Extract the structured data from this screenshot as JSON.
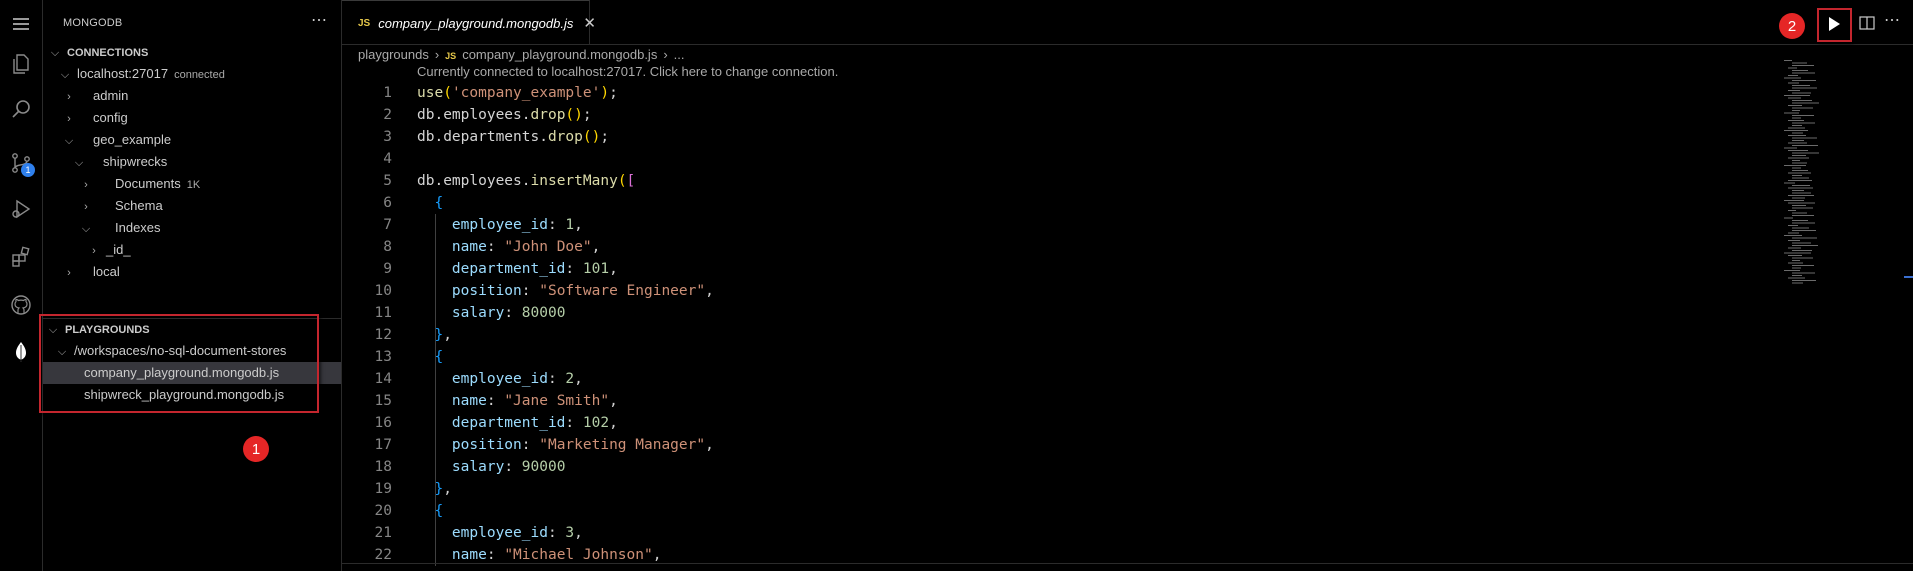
{
  "sidebar": {
    "title": "MONGODB",
    "connections_header": "CONNECTIONS",
    "connection": {
      "name": "localhost:27017",
      "status": "connected"
    },
    "tree": {
      "admin": "admin",
      "config": "config",
      "geo_example": "geo_example",
      "shipwrecks": "shipwrecks",
      "documents": "Documents",
      "documents_count": "1K",
      "schema": "Schema",
      "indexes": "Indexes",
      "id_index": "_id_",
      "local": "local"
    },
    "playgrounds_header": "PLAYGROUNDS",
    "playground_folder": "/workspaces/no-sql-document-stores",
    "playground_files": [
      "company_playground.mongodb.js",
      "shipwreck_playground.mongodb.js"
    ]
  },
  "activity": {
    "scm_badge": "1"
  },
  "annotations": {
    "step1": "1",
    "step2": "2"
  },
  "editor": {
    "tab_lang": "JS",
    "tab_title": "company_playground.mongodb.js",
    "breadcrumb": [
      "playgrounds",
      "company_playground.mongodb.js",
      "..."
    ],
    "codelens": "Currently connected to localhost:27017. Click here to change connection.",
    "lines": [
      "use('company_example');",
      "db.employees.drop();",
      "db.departments.drop();",
      "",
      "db.employees.insertMany([",
      "  {",
      "    employee_id: 1,",
      "    name: \"John Doe\",",
      "    department_id: 101,",
      "    position: \"Software Engineer\",",
      "    salary: 80000",
      "  },",
      "  {",
      "    employee_id: 2,",
      "    name: \"Jane Smith\",",
      "    department_id: 102,",
      "    position: \"Marketing Manager\",",
      "    salary: 90000",
      "  },",
      "  {",
      "    employee_id: 3,",
      "    name: \"Michael Johnson\","
    ]
  },
  "colors": {
    "background": "#000000",
    "annotation_red": "#e52626",
    "selection": "#37373d",
    "js_badge": "#e6c84a"
  }
}
